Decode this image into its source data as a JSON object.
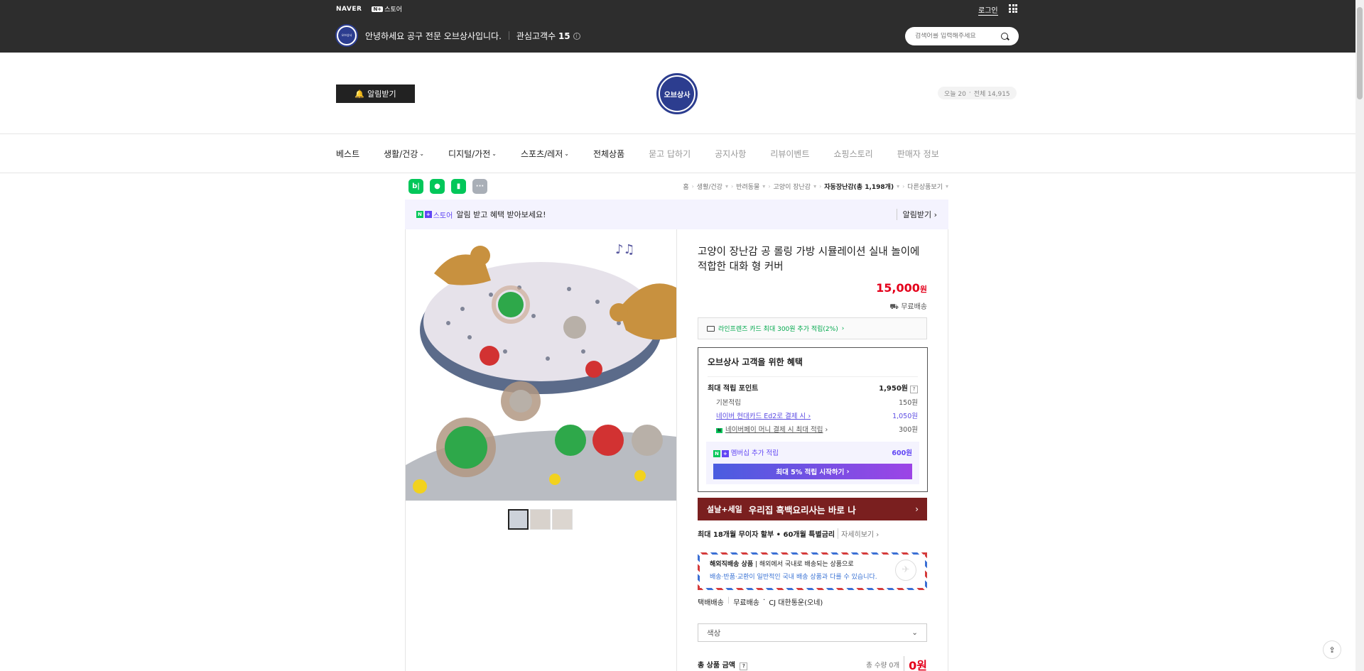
{
  "topbar": {
    "naver": "NAVER",
    "store_np": "N+",
    "store_label": "스토어",
    "login": "로그인",
    "store_badge_text": "오브상사",
    "greeting": "안녕하세요 공구 전문 오브상사입니다.",
    "fans_label": "관심고객수",
    "fans_count": "15",
    "search_placeholder": "검색어를 입력해주세요"
  },
  "header": {
    "notify_button": "알림받기",
    "logo_text": "오브상사",
    "visit_today": "오늘 20",
    "visit_total": "전체 14,915"
  },
  "nav": [
    {
      "label": "베스트",
      "style": "dark",
      "dropdown": false
    },
    {
      "label": "생활/건강",
      "style": "dark",
      "dropdown": true
    },
    {
      "label": "디지털/가전",
      "style": "dark",
      "dropdown": true
    },
    {
      "label": "스포츠/레저",
      "style": "dark",
      "dropdown": true
    },
    {
      "label": "전체상품",
      "style": "dark",
      "dropdown": false
    },
    {
      "label": "묻고 답하기",
      "style": "light",
      "dropdown": false
    },
    {
      "label": "공지사항",
      "style": "light",
      "dropdown": false
    },
    {
      "label": "리뷰이벤트",
      "style": "light",
      "dropdown": false
    },
    {
      "label": "쇼핑스토리",
      "style": "light",
      "dropdown": false
    },
    {
      "label": "판매자 정보",
      "style": "light",
      "dropdown": false
    }
  ],
  "share_icons": [
    "b|",
    "talk",
    "bookmark",
    "more"
  ],
  "breadcrumb": [
    "홈",
    "생활/건강",
    "반려동물",
    "고양이 장난감",
    "자동장난감(총 1,198개)",
    "다른상품보기"
  ],
  "promo": {
    "n": "N",
    "plus": "+",
    "store": "스토어",
    "text": "알림 받고 혜택 받아보세요!",
    "right": "알림받기"
  },
  "product": {
    "title": "고양이 장난감 공 롤링 가방 시뮬레이션 실내 놀이에 적합한 대화 형 커버",
    "price": "15,000",
    "price_unit": "원",
    "shipping": "무료배송",
    "card_benefit": "라인프렌즈 카드 최대 300원 추가 적립(2%)",
    "benefit_title": "오브상사 고객을 위한 혜택",
    "max_points_label": "최대 적립 포인트",
    "max_points": "1,950원",
    "basic_label": "기본적립",
    "basic_value": "150원",
    "hyundai_label": "네이버 현대카드 Ed2로 결제 시",
    "hyundai_value": "1,050원",
    "npay_label": "네이버페이 머니 결제 시 최대 적립",
    "npay_value": "300원",
    "member_label": "멤버십 추가 적립",
    "member_value": "600원",
    "member_button": "최대 5% 적립 시작하기",
    "banner_t1": "설날+세일",
    "banner_t2": "우리집 흑백요리사는 바로 나",
    "installment": "최대 18개월 무이자 할부 • 60개월 특별금리",
    "installment_more": "자세히보기",
    "intl_title": "해외직배송 상품",
    "intl_desc1": "해외에서 국내로 배송되는 상품으로",
    "intl_desc2": "배송·반품·교환이 일반적인 국내 배송 상품과 다를 수 있습니다.",
    "delivery_type": "택배배송",
    "delivery_fee": "무료배송",
    "delivery_carrier": "CJ 대한통운(오네)",
    "option_placeholder": "색상",
    "total_label": "총 상품 금액",
    "total_qty": "총 수량 0개",
    "total_amount": "0원"
  },
  "colors": {
    "price_red": "#e4001b",
    "naver_green": "#03c75a",
    "plus_purple": "#6146f4",
    "topbar_bg": "#2d2d2d",
    "brand_navy": "#2c3d8f"
  }
}
